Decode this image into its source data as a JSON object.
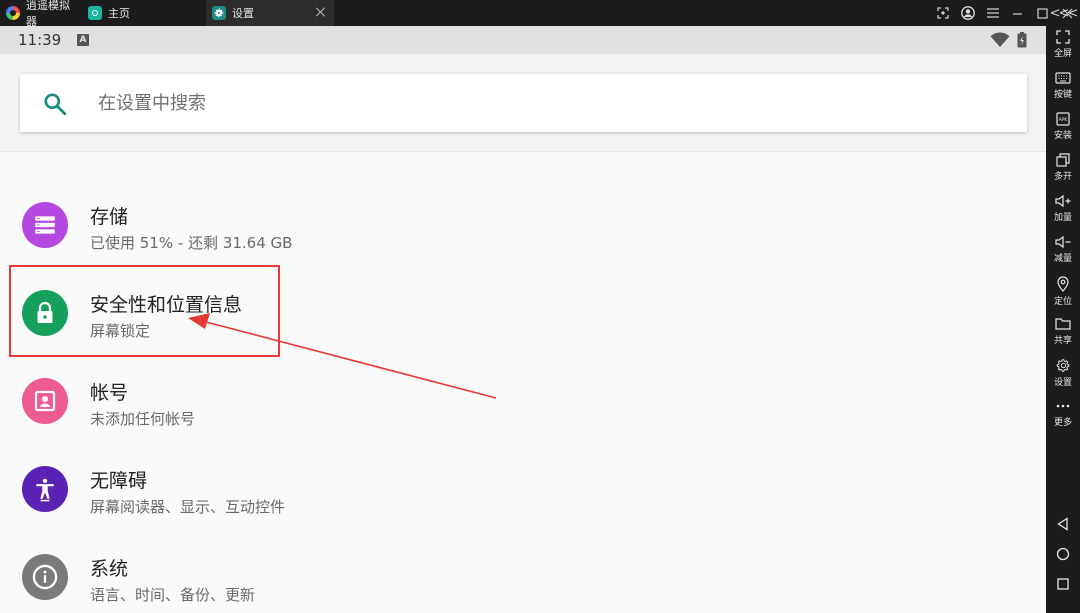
{
  "emulator": {
    "tabs": [
      {
        "label": "逍遥模拟器"
      },
      {
        "label": "主页"
      },
      {
        "label": "设置"
      }
    ]
  },
  "statusbar": {
    "time": "11:39",
    "notification_glyph": "A"
  },
  "search": {
    "placeholder": "在设置中搜索"
  },
  "settings_items": [
    {
      "title": "存储",
      "subtitle": "已使用 51% - 还剩 31.64 GB",
      "icon": "storage-icon",
      "color": "#b548de"
    },
    {
      "title": "安全性和位置信息",
      "subtitle": "屏幕锁定",
      "icon": "lock-icon",
      "color": "#16a05d"
    },
    {
      "title": "帐号",
      "subtitle": "未添加任何帐号",
      "icon": "account-icon",
      "color": "#ed5c90"
    },
    {
      "title": "无障碍",
      "subtitle": "屏幕阅读器、显示、互动控件",
      "icon": "accessibility-icon",
      "color": "#5b23b5"
    },
    {
      "title": "系统",
      "subtitle": "语言、时间、备份、更新",
      "icon": "info-icon",
      "color": "#7a7a7a"
    }
  ],
  "toolbar": {
    "top_glyph": "<<<",
    "buttons": [
      {
        "label": "全屏"
      },
      {
        "label": "按键"
      },
      {
        "label": "安装"
      },
      {
        "label": "多开"
      },
      {
        "label": "加量"
      },
      {
        "label": "减量"
      },
      {
        "label": "定位"
      },
      {
        "label": "共享"
      },
      {
        "label": "设置"
      },
      {
        "label": "更多"
      }
    ]
  },
  "colors": {
    "accent": "#188b7d",
    "highlight": "#e53935"
  }
}
